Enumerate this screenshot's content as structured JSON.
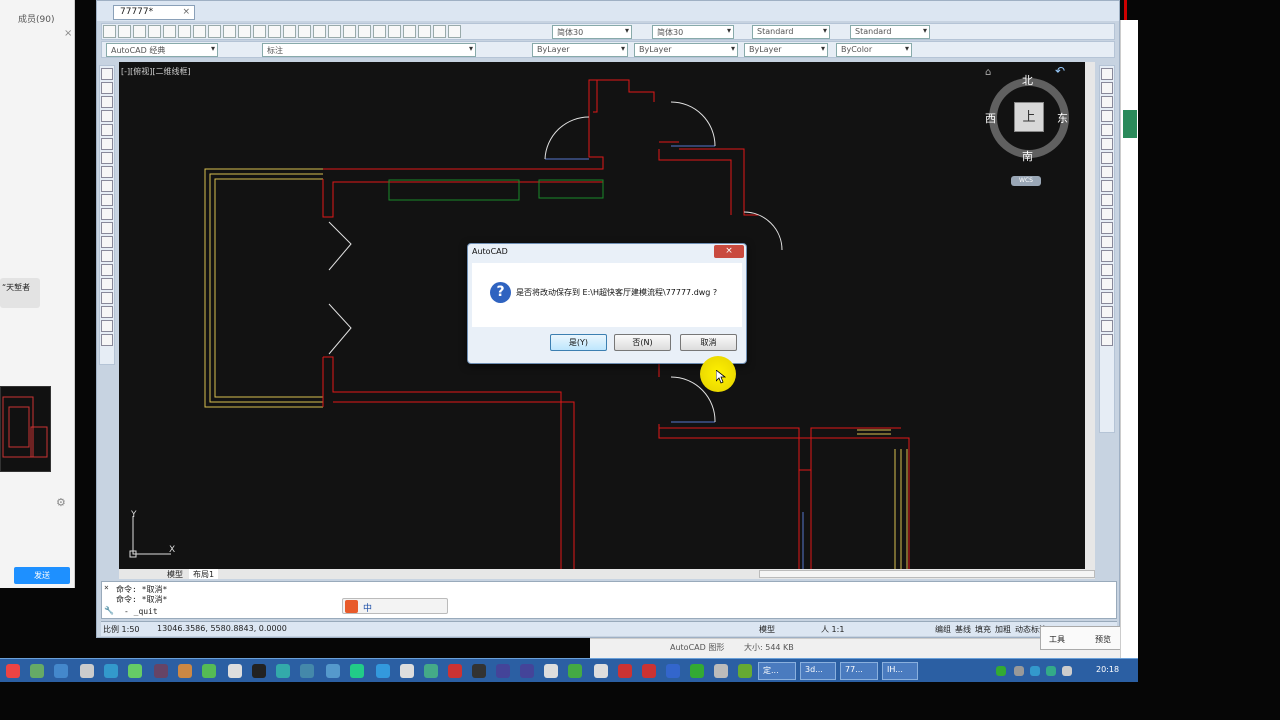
{
  "chat": {
    "members_label": "成员(90)",
    "close_symbol": "×",
    "message_snippet": "“天堑者",
    "send_label": "发送",
    "gear_symbol": "⚙"
  },
  "acad": {
    "doc_tab": "77777*",
    "doc_tab_close": "×",
    "workspace": "AutoCAD 经典",
    "layer": "标注",
    "text_style": "简体30",
    "dim_style": "简体30",
    "table_style": "Standard",
    "multileader_style": "Standard",
    "color": "ByLayer",
    "linetype": "ByLayer",
    "lineweight": "ByLayer",
    "plotstyle": "ByColor",
    "viewport_label": "[-][俯视][二维线框]",
    "viewcube": {
      "north": "北",
      "south": "南",
      "east": "东",
      "west": "西",
      "face": "上",
      "wcs": "WCS"
    },
    "ucs_x": "X",
    "ucs_y": "Y",
    "tabs": [
      "模型",
      "布局1"
    ],
    "command_lines": [
      "命令: *取消*",
      "命令: *取消*"
    ],
    "command_input": "- _quit",
    "status": {
      "scale": "比例 1:50",
      "coords": "13046.3586, 5580.8843, 0.0000",
      "model": "模型",
      "anno_scale": "人 1:1",
      "buttons": [
        "编组",
        "基线",
        "填充",
        "加粗",
        "动态标注"
      ]
    }
  },
  "dialog": {
    "title": "AutoCAD",
    "close_symbol": "×",
    "message": "是否将改动保存到 E:\\H超快客厅建模流程\\77777.dwg ?",
    "yes": "是(Y)",
    "no": "否(N)",
    "cancel": "取消"
  },
  "preview": {
    "filetype": "AutoCAD 图形",
    "size": "大小: 544 KB"
  },
  "popup": {
    "tools": "工具",
    "preview": "预览"
  },
  "taskbar": {
    "tasks": [
      "定...",
      "3d...",
      "77...",
      "IH..."
    ],
    "time": "20:18"
  },
  "colors": {
    "canvas_bg": "#121212",
    "wall_red": "#e01818",
    "window_yellow": "#d8c050",
    "door_white": "#e0e0e0",
    "cabinet_green": "#1a8a2a",
    "dialog_accent": "#2f63c0"
  }
}
